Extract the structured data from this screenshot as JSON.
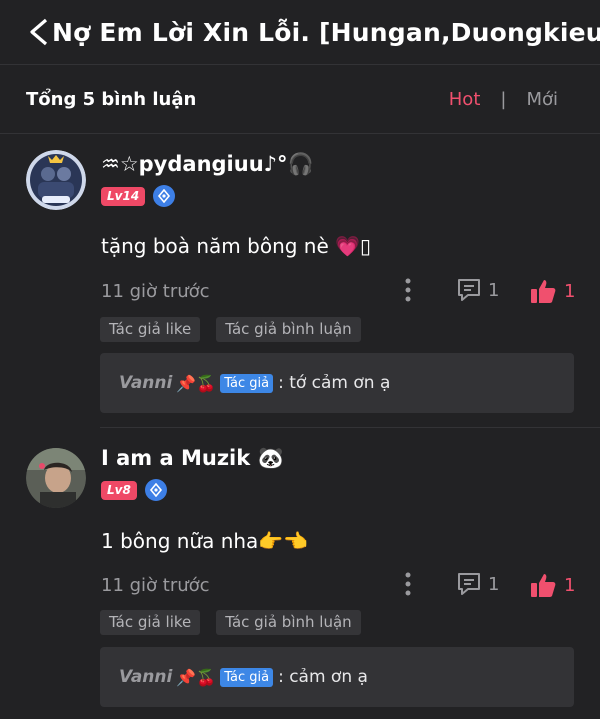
{
  "header": {
    "title": "Nợ Em Lời Xin Lỗi. [Hungan,Duongkieu]"
  },
  "sort_bar": {
    "total": "Tổng 5 bình luận",
    "hot": "Hot",
    "separator": "|",
    "newest": "Mới"
  },
  "comments": [
    {
      "username": "♒☆pydangiuu♪°🎧",
      "level": "Lv14",
      "text": "tặng boà năm bông nè 💗▯",
      "time": "11 giờ trước",
      "reply_count": "1",
      "like_count": "1",
      "tags": [
        "Tác giả like",
        "Tác giả bình luận"
      ],
      "reply": {
        "name": "Vanni",
        "emoji": "📌🍒",
        "badge": "Tác giả",
        "text": ": tớ cảm ơn ạ"
      }
    },
    {
      "username": "I am a Muzik 🐼",
      "level": "Lv8",
      "text": "1 bông nữa nha👉👈",
      "time": "11 giờ trước",
      "reply_count": "1",
      "like_count": "1",
      "tags": [
        "Tác giả like",
        "Tác giả bình luận"
      ],
      "reply": {
        "name": "Vanni",
        "emoji": "📌🍒",
        "badge": "Tác giả",
        "text": ": cảm ơn ạ"
      }
    }
  ]
}
